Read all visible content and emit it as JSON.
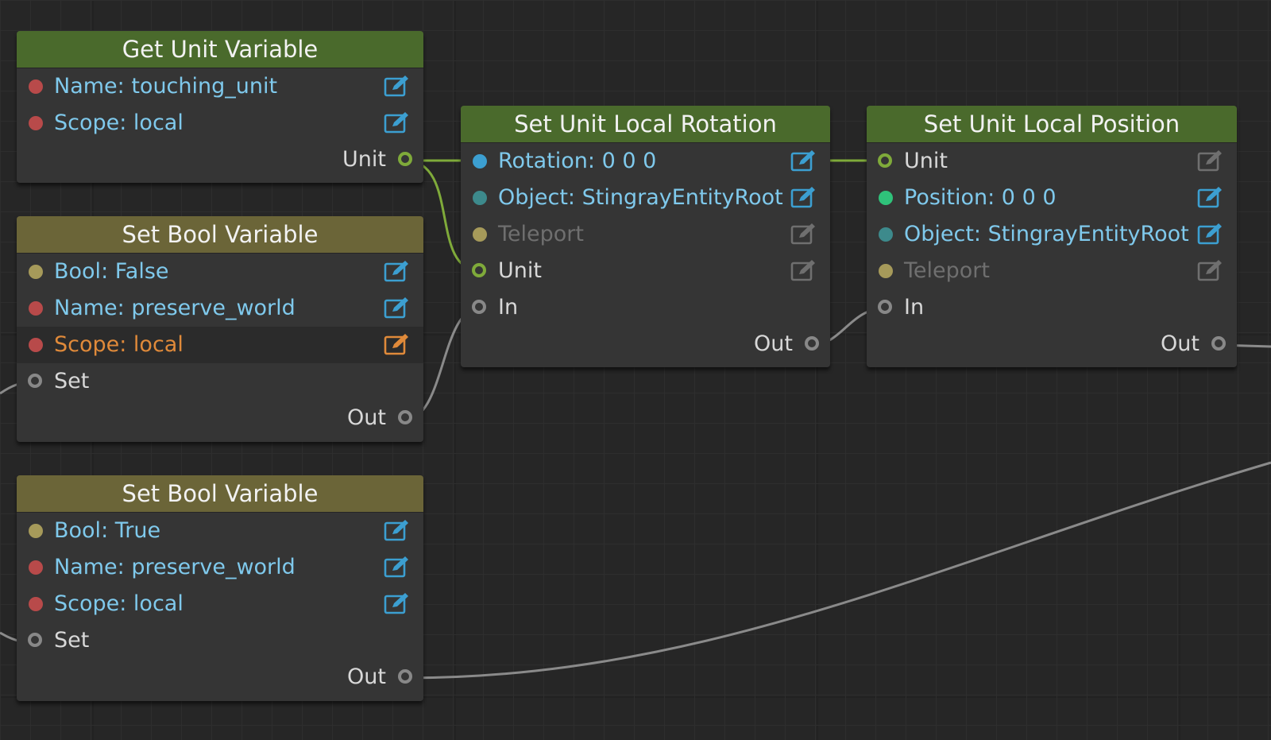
{
  "colors": {
    "background": "#262626",
    "node_body": "#353535",
    "header_green": "#4a6a2c",
    "header_olive": "#6b6538",
    "value_text": "#7fc9ec",
    "highlight_text": "#e08a3a",
    "wire_green": "#7faa3a",
    "wire_gray": "#8a8a8a"
  },
  "nodes": {
    "get_unit_variable": {
      "title": "Get Unit Variable",
      "name": "Name: touching_unit",
      "scope": "Scope: local",
      "out_unit": "Unit"
    },
    "set_bool_variable_1": {
      "title": "Set Bool Variable",
      "bool": "Bool: False",
      "name": "Name: preserve_world",
      "scope": "Scope: local",
      "in_set": "Set",
      "out": "Out"
    },
    "set_bool_variable_2": {
      "title": "Set Bool Variable",
      "bool": "Bool: True",
      "name": "Name: preserve_world",
      "scope": "Scope: local",
      "in_set": "Set",
      "out": "Out"
    },
    "set_unit_local_rotation": {
      "title": "Set Unit Local Rotation",
      "rotation": "Rotation: 0 0 0",
      "object": "Object: StingrayEntityRoot",
      "teleport": "Teleport",
      "unit": "Unit",
      "in": "In",
      "out": "Out"
    },
    "set_unit_local_position": {
      "title": "Set Unit Local Position",
      "unit": "Unit",
      "position": "Position: 0 0 0",
      "object": "Object: StingrayEntityRoot",
      "teleport": "Teleport",
      "in": "In",
      "out": "Out"
    }
  }
}
